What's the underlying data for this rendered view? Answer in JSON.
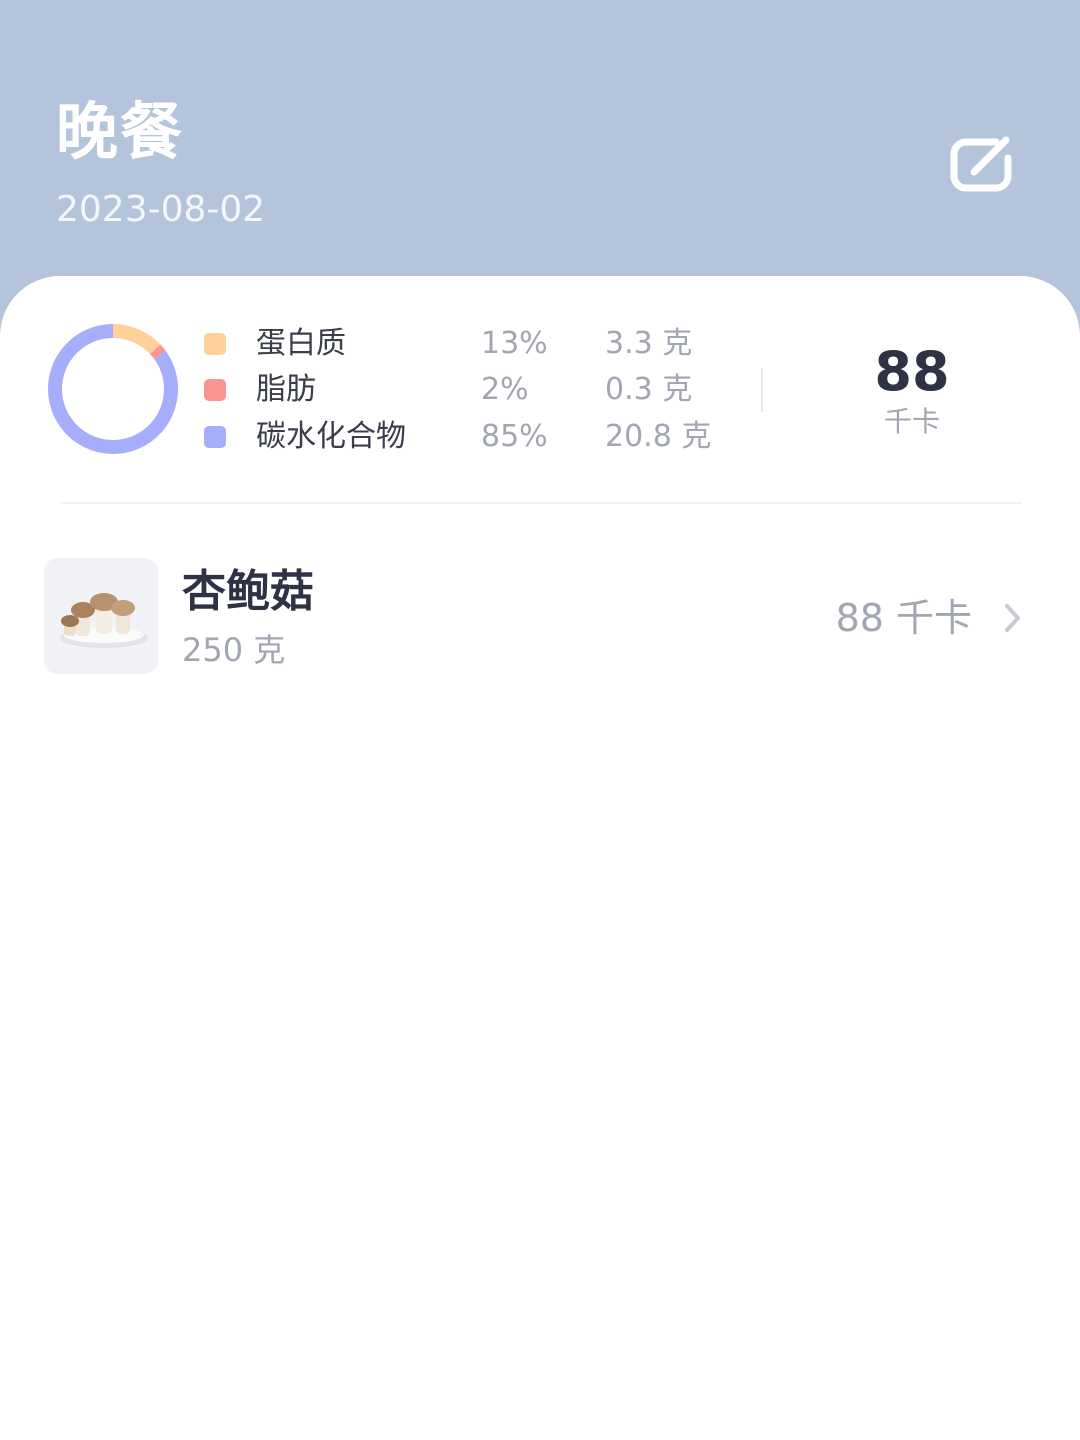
{
  "header": {
    "title": "晚餐",
    "date": "2023-08-02",
    "edit_icon": "edit-icon"
  },
  "summary": {
    "macros": [
      {
        "name": "蛋白质",
        "percent": "13%",
        "amount": "3.3 克",
        "color": "#ffd09a"
      },
      {
        "name": "脂肪",
        "percent": "2%",
        "amount": "0.3 克",
        "color": "#f99590"
      },
      {
        "name": "碳水化合物",
        "percent": "85%",
        "amount": "20.8 克",
        "color": "#a6adfa"
      }
    ],
    "total_kcal": "88",
    "kcal_unit": "千卡"
  },
  "foods": [
    {
      "name": "杏鲍菇",
      "quantity": "250 克",
      "kcal": "88 千卡",
      "thumbnail_icon": "king-oyster-mushroom-photo",
      "chevron_icon": "chevron-right-icon"
    }
  ],
  "colors": {
    "header_bg": "#b4c5db",
    "card_bg": "#ffffff",
    "primary_text": "#2e3244",
    "secondary_text": "#a2a6b2"
  }
}
